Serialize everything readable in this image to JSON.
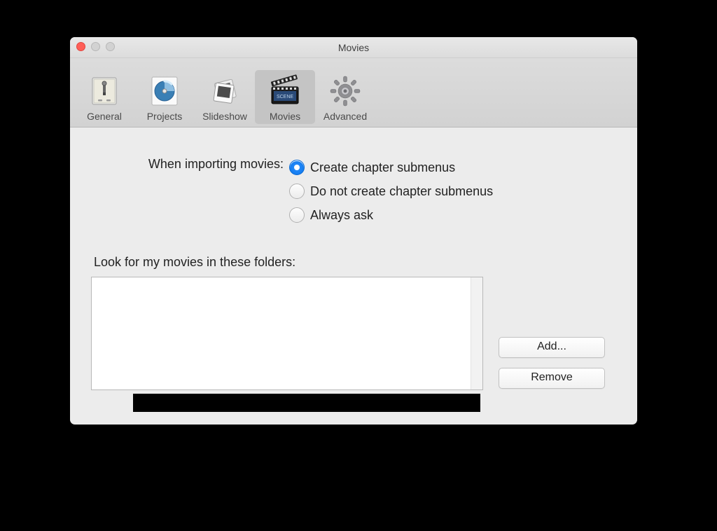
{
  "window": {
    "title": "Movies"
  },
  "toolbar": {
    "items": [
      {
        "label": "General",
        "selected": false
      },
      {
        "label": "Projects",
        "selected": false
      },
      {
        "label": "Slideshow",
        "selected": false
      },
      {
        "label": "Movies",
        "selected": true
      },
      {
        "label": "Advanced",
        "selected": false
      }
    ]
  },
  "importing": {
    "label": "When importing movies:",
    "options": [
      {
        "label": "Create chapter submenus",
        "selected": true
      },
      {
        "label": "Do not create chapter submenus",
        "selected": false
      },
      {
        "label": "Always ask",
        "selected": false
      }
    ]
  },
  "folders": {
    "label": "Look for my movies in these folders:",
    "items": []
  },
  "buttons": {
    "add": "Add...",
    "remove": "Remove"
  }
}
